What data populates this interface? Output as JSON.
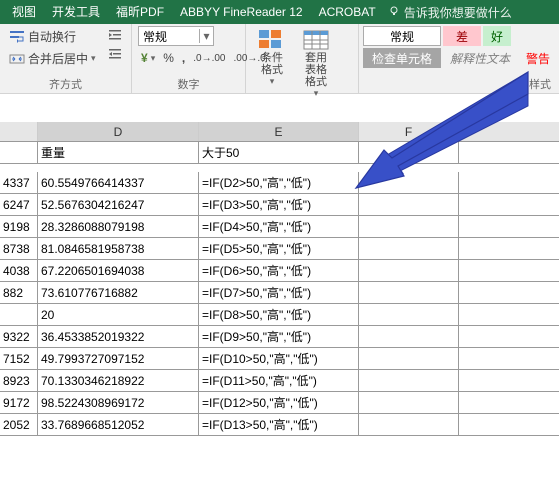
{
  "ribbon": {
    "tabs": [
      "视图",
      "开发工具",
      "福昕PDF",
      "ABBYY FineReader 12",
      "ACROBAT"
    ],
    "tell_me": "告诉我你想要做什么",
    "wrap_text": "自动换行",
    "merge_center": "合并后居中",
    "align_group": "齐方式",
    "number_format": "常规",
    "number_group": "数字",
    "cond_format": "条件格式",
    "table_format": "套用\n表格格式",
    "style_normal": "常规",
    "style_bad": "差",
    "style_good": "好",
    "style_check": "检查单元格",
    "style_explain": "解释性文本",
    "style_warn": "警告",
    "styles_group": "样式"
  },
  "sheet": {
    "cols": [
      "D",
      "E",
      "F"
    ],
    "header": {
      "c": "",
      "d": "重量",
      "e": "大于50"
    },
    "rows": [
      {
        "c": "4337",
        "d": "60.5549766414337",
        "e": "=IF(D2>50,\"高\",\"低\")"
      },
      {
        "c": "6247",
        "d": "52.5676304216247",
        "e": "=IF(D3>50,\"高\",\"低\")"
      },
      {
        "c": "9198",
        "d": "28.3286088079198",
        "e": "=IF(D4>50,\"高\",\"低\")"
      },
      {
        "c": "8738",
        "d": "81.0846581958738",
        "e": "=IF(D5>50,\"高\",\"低\")"
      },
      {
        "c": "4038",
        "d": "67.2206501694038",
        "e": "=IF(D6>50,\"高\",\"低\")"
      },
      {
        "c": "882",
        "d": "73.610776716882",
        "e": "=IF(D7>50,\"高\",\"低\")"
      },
      {
        "c": "",
        "d": "20",
        "e": "=IF(D8>50,\"高\",\"低\")"
      },
      {
        "c": "9322",
        "d": "36.4533852019322",
        "e": "=IF(D9>50,\"高\",\"低\")"
      },
      {
        "c": "7152",
        "d": "49.7993727097152",
        "e": "=IF(D10>50,\"高\",\"低\")"
      },
      {
        "c": "8923",
        "d": "70.1330346218922",
        "e": "=IF(D11>50,\"高\",\"低\")"
      },
      {
        "c": "9172",
        "d": "98.5224308969172",
        "e": "=IF(D12>50,\"高\",\"低\")"
      },
      {
        "c": "2052",
        "d": "33.7689668512052",
        "e": "=IF(D13>50,\"高\",\"低\")"
      }
    ]
  }
}
